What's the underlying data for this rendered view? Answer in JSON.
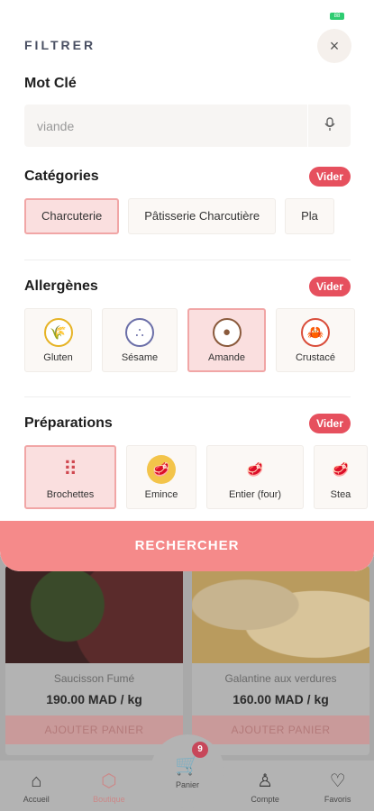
{
  "status": {
    "battery_label": "88"
  },
  "filter": {
    "title": "FILTRER",
    "close_icon": "×",
    "keyword": {
      "label": "Mot Clé",
      "value": "viande",
      "mic_icon": "🎙"
    },
    "categories": {
      "label": "Catégories",
      "clear_label": "Vider",
      "items": [
        {
          "label": "Charcuterie",
          "selected": true
        },
        {
          "label": "Pâtisserie Charcutière",
          "selected": false
        },
        {
          "label": "Pla",
          "selected": false
        }
      ]
    },
    "allergens": {
      "label": "Allergènes",
      "clear_label": "Vider",
      "items": [
        {
          "label": "Gluten",
          "icon": "wheat-icon",
          "glyph": "🌾",
          "color": "#e6b325",
          "selected": false
        },
        {
          "label": "Sésame",
          "icon": "sesame-icon",
          "glyph": "∴",
          "color": "#6b6fa8",
          "selected": false
        },
        {
          "label": "Amande",
          "icon": "almond-icon",
          "glyph": "●",
          "color": "#8a5a3c",
          "selected": true
        },
        {
          "label": "Crustacé",
          "icon": "crab-icon",
          "glyph": "🦀",
          "color": "#d94d3a",
          "selected": false
        }
      ]
    },
    "preparations": {
      "label": "Préparations",
      "clear_label": "Vider",
      "items": [
        {
          "label": "Brochettes",
          "icon": "brochettes-icon",
          "glyph": "⠿",
          "selected": true
        },
        {
          "label": "Emince",
          "icon": "emince-icon",
          "glyph": "🥩",
          "selected": false
        },
        {
          "label": "Entier (four)",
          "icon": "roast-icon",
          "glyph": "🥩",
          "selected": false
        },
        {
          "label": "Stea",
          "icon": "steak-icon",
          "glyph": "🥩",
          "selected": false
        }
      ]
    },
    "search_button": "RECHERCHER"
  },
  "products": [
    {
      "name": "Saucisson Fumé",
      "price": "190.00 MAD / kg",
      "button": "AJOUTER PANIER"
    },
    {
      "name": "Galantine aux verdures",
      "price": "160.00 MAD / kg",
      "button": "AJOUTER PANIER"
    }
  ],
  "nav": {
    "items": [
      {
        "label": "Accueil",
        "icon": "home-icon"
      },
      {
        "label": "Boutique",
        "icon": "box-icon"
      },
      {
        "label": "Compte",
        "icon": "user-icon"
      },
      {
        "label": "Favoris",
        "icon": "heart-icon"
      }
    ],
    "cart": {
      "label": "Panier",
      "count": "9",
      "icon": "cart-icon"
    }
  },
  "colors": {
    "accent": "#e6505e",
    "cta": "#f58a8a",
    "selected_bg": "#fadfdf"
  }
}
